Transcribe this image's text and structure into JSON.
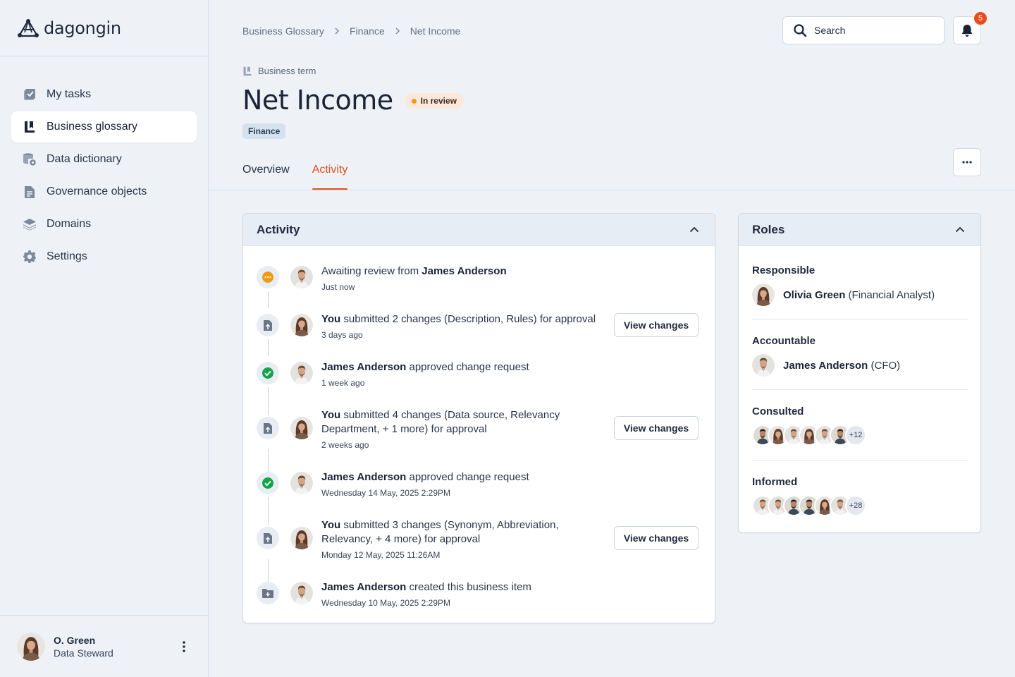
{
  "app": {
    "name": "dagongin"
  },
  "sidebar": {
    "items": [
      {
        "label": "My tasks",
        "icon": "tasks-icon"
      },
      {
        "label": "Business glossary",
        "icon": "book-icon",
        "active": true
      },
      {
        "label": "Data dictionary",
        "icon": "database-icon"
      },
      {
        "label": "Governance objects",
        "icon": "document-icon"
      },
      {
        "label": "Domains",
        "icon": "layers-icon"
      },
      {
        "label": "Settings",
        "icon": "gear-icon"
      }
    ],
    "user": {
      "name": "O. Green",
      "role": "Data Steward"
    }
  },
  "header": {
    "breadcrumb": [
      "Business Glossary",
      "Finance",
      "Net Income"
    ],
    "search_placeholder": "Search",
    "notifications": "5"
  },
  "term": {
    "type": "Business term",
    "title": "Net Income",
    "status": "In review",
    "tag": "Finance"
  },
  "tabs": [
    {
      "label": "Overview"
    },
    {
      "label": "Activity",
      "active": true
    }
  ],
  "activity": {
    "title": "Activity",
    "view_label": "View changes",
    "items": [
      {
        "icon": "pending-icon",
        "actor": "",
        "pre": "Awaiting review from ",
        "bold": "James Anderson",
        "post": "",
        "time": "Just now",
        "avatar": "man"
      },
      {
        "icon": "document-upload-icon",
        "pre": "",
        "bold": "You",
        "post": " submitted 2 changes (Description, Rules) for approval",
        "time": "3 days ago",
        "avatar": "woman",
        "button": true
      },
      {
        "icon": "approved-icon",
        "pre": "",
        "bold": "James Anderson",
        "post": " approved change request",
        "time": "1 week ago",
        "avatar": "man"
      },
      {
        "icon": "document-upload-icon",
        "pre": "",
        "bold": "You",
        "post": " submitted 4 changes (Data source, Relevancy Department, + 1 more) for approval",
        "time": "2 weeks ago",
        "avatar": "woman",
        "button": true
      },
      {
        "icon": "approved-icon",
        "pre": "",
        "bold": "James Anderson",
        "post": " approved change request",
        "time": "Wednesday 14 May, 2025 2:29PM",
        "avatar": "man"
      },
      {
        "icon": "document-upload-icon",
        "pre": "",
        "bold": "You",
        "post": " submitted 3 changes (Synonym, Abbreviation, Relevancy, + 4 more) for approval",
        "time": "Monday 12 May, 2025 11:26AM",
        "avatar": "woman",
        "button": true
      },
      {
        "icon": "folder-add-icon",
        "pre": "",
        "bold": "James Anderson",
        "post": " created this business item",
        "time": "Wednesday 10 May, 2025 2:29PM",
        "avatar": "man"
      }
    ]
  },
  "roles": {
    "title": "Roles",
    "responsible": {
      "label": "Responsible",
      "name": "Olivia Green",
      "detail": " (Financial Analyst)"
    },
    "accountable": {
      "label": "Accountable",
      "name": "James Anderson",
      "detail": " (CFO)"
    },
    "consulted": {
      "label": "Consulted",
      "more": "+12"
    },
    "informed": {
      "label": "Informed",
      "more": "+28"
    }
  },
  "colors": {
    "accent": "#e0501e",
    "pending": "#f29a14",
    "approved": "#17a34a",
    "badge": "#ea4b1f"
  }
}
